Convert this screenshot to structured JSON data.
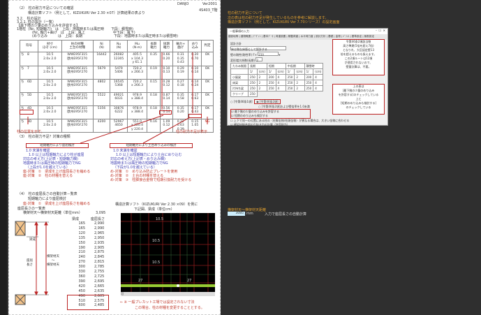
{
  "header": {
    "danjo": "DANJO",
    "ver": "Ver2001",
    "sheet": "4S403_T階"
  },
  "sec2": {
    "title": "（2）　柱の耐力不足についての確認",
    "sub": "構造計算ソフト（例として、KIZUKURI Ver 2.30 ×07）計算結果の表より",
    "l1": "3.2.　柱の設計",
    "l2": "3.2.1. 柱の設計（一覧）",
    "l3": "【最下階の少量のめり込みを許容する】",
    "l4a": "1階柱",
    "l4b": "(Nc, 短期軸力)　は　上段：地震時または風圧時　　下段：積雪時)",
    "l5": "(Nc, 軸力+曲げ　は　上段：風上　　　　　　　　中下段：風下)",
    "l6": "(めり込み　　　は　上段：長期　　　　　　　　　下段：地震時または風圧時または積雪時)"
  },
  "table": {
    "headers": [
      "符号",
      "材寸\nほぞ (cm)",
      "柱の材種\n土台の材種",
      "Ni\n(N)",
      "Nu\n(N)",
      "Mu\n(N·m)",
      "長期\n軸力",
      "短期\n軸力",
      "軸力+\n曲げ",
      "めり\n込み",
      "判定"
    ],
    "rows": [
      [
        "ち　8",
        "10.5\n2.0x 2.0",
        "WWE95F315\n欧州E95F270",
        "16442",
        "26082\n12305",
        "405.5\nx 104.3\ny 61.1",
        "0.35",
        "0.66\n0.20",
        "0.31\n0.35\n0.43",
        "0.20\n0.70",
        "OK"
      ],
      [
        "ち　7",
        "10.5\n2.0x 2.0",
        "WWE95F315\n欧州E95F270",
        "5679",
        "5479\n5406",
        "720.2\nx 266.3",
        "0.19",
        "0.10\n0.13",
        "0.29\n0.19",
        "0.10\n0.14",
        "OK"
      ],
      [
        "ち　6D",
        "10.5\n2.0x 2.0",
        "WWE95F315\n欧州E95F270",
        "4802",
        "16545\n5368",
        "720.2\nx 266.3",
        "0.15",
        "0.28\n0.12",
        "0.27\n0.18",
        "0.14\n0.24",
        "OK"
      ],
      [
        "ち　5D",
        "10.5\n2.0x 2.0",
        "WWE95F315\n欧州E95F270",
        "5522",
        "49021\n6031",
        "978.9\nx 388.4",
        "0.18",
        "0.87\n0.14",
        "0.35\n0.58",
        "0.17\n0.63",
        "OK"
      ],
      [
        "ち　4D",
        "10.5\n2.0x 2.0",
        "WWE95F315\n欧州E95F270",
        "5356",
        "30876\n6222",
        "978.9\nx 388.4",
        "0.18",
        "0.56\n0.14",
        "0.35\n0.20",
        "0.17\n0.43",
        "OK"
      ],
      [
        "ち　3D",
        "10.5\n2.0x 2.0",
        "WWE95F315\n欧州E95F270",
        "4200",
        "52967\n4650",
        "551.0\nx 220.4\ny 220.4",
        "0.16",
        "1.09\n0.12",
        "0.22\n0.63\n0.39",
        "0.15\n1.05",
        "NG"
      ]
    ]
  },
  "notes": {
    "left": "柱の位置を示す。",
    "right": "柱の耐力不足が表示"
  },
  "sec3": {
    "title": "（3）　柱の耐力不足？対策の種類",
    "left": {
      "box": "短期軸力により座屈検討",
      "lines": [
        "1.0 未満を確認",
        "1.0 以上は短期軸力により柱が座屈",
        "対応の考え方(上記表・短期軸力欄)",
        "地震時または風圧時の短期軸力でNG",
        "（上段が1.0を越えている）",
        "座-対策　①　梁成を上げ座屈長さを縮める",
        "座-対策　②　柱の材種を替える"
      ]
    },
    "right": {
      "box": "短期軸力により土台めり込みの検討",
      "lines": [
        "1.0 未満を確認",
        "1.0 以上は短期軸力により土台にめり込む",
        "対応の考え方(上記表・めり込み欄)",
        "地震時または風圧時の短期軸力でNG",
        "（下段が1.0を越えている）",
        "め-対策　①　めり込み防止プレートを使用",
        "め-対策　②　土台の材種を替える",
        "め-対策　③　柱脚接合金物で短期引抜耐力を受ける"
      ]
    }
  },
  "sec4": {
    "title": "（4）　柱の座屈長さの自動計算－覧表",
    "l1": "短期軸力により座屈検討",
    "l2": "座-対策　①　梁成を上げ座屈長さを縮める",
    "l3": "座屈長さの一覧表",
    "l4": "横架材天～横架材天距離（単位mm）",
    "l4v": "3,095",
    "h1": "梁成",
    "h2": "座屈長さ",
    "beam": [
      "165",
      "165",
      "120",
      "135",
      "150",
      "190",
      "210",
      "240",
      "270",
      "300",
      "330",
      "360",
      "390",
      "420",
      "450",
      "490",
      "510",
      "600"
    ],
    "len": [
      "2,990",
      "2,990",
      "2,965",
      "2,950",
      "2,935",
      "2,905",
      "2,875",
      "2,845",
      "2,815",
      "2,785",
      "2,755",
      "2,725",
      "2,695",
      "2,665",
      "2,635",
      "2,605",
      "2,575",
      "2,485"
    ],
    "diag": {
      "beam": "梁成",
      "between": "横架材天\n～\n横架材天",
      "buckle": "座屈\n長さ"
    },
    "cad_title": "構造計算ソフト（KIZUKURI Ver 2.30 ×09）を例に",
    "cad_sub": "下記図、梁成（単位cm）",
    "cad_labels": [
      "10.5",
      "10.5",
      "10.5",
      "27",
      "27"
    ],
    "cad_tab": "可",
    "foot1": "← ※ 一般プレカット工場では設定されない寸法",
    "foot2": "この場合、柱の材種を変更することとする。"
  },
  "right": {
    "t1": "柱の耐力不足について",
    "t2": "次の表は柱の耐力不足が発生しているものを参考に解説します。",
    "t3": "構造計算ソフト（例として、KIZUKURI Ver 7.70シリーズ）の設定画面",
    "dialog": {
      "title": "一般事項の入力",
      "tabs": "建設地等 | 建物概要 | ﾃﾞｻﾞｲﾝ | 基本ﾃﾞｰﾀ | 荷重設置 | 積載荷重 | 水平荷力度 | 設計方針 | 基礎 | 金物 | ﾊﾞﾗﾝｽ | 基準設定 | 無断設定",
      "section": "設計方針",
      "r1": "床は剛な床版として設計する",
      "r2": "壁の剛性(剛性率) F×",
      "r2v": "150",
      "r3": "変形増大係数(長期)",
      "r3v": "2",
      "tawami": "たわみ制限",
      "cols": [
        "長期",
        "短期",
        "中長期",
        "積雪時"
      ],
      "sub": [
        "1/",
        "(cm)"
      ],
      "rows": [
        [
          "小屋梁",
          "250",
          "2",
          "200",
          "4",
          "250",
          "2",
          "200",
          "4"
        ],
        [
          "床梁",
          "250",
          "2",
          "250",
          "4",
          "250",
          "2",
          "250",
          "4"
        ],
        [
          "片持ち梁",
          "250",
          "2",
          "250",
          "4",
          "250",
          "2",
          "250",
          "4"
        ]
      ],
      "creep": "クリープ",
      "creepv": "250",
      "opt1": "[令第46条1項]",
      "opt2": "[令第46条2項]",
      "opt3": "[令第46条2項]および壁倍率を1.0未満",
      "c1": "最下階の少量のめり込みを許容する",
      "c2": "短期のめり込みも検討する",
      "c3": "上下で同一の位置にある柱の（柱脚金物/柱頭金物）が異なる場合は、大きい金物に合わせる",
      "c4": "横架材接合部の引抜き力の計算（許容耐力）"
    },
    "note1": [
      "令第46条2項該当物",
      "高さ準建(5倍を超え7倍)",
      "となりれ、大臣認定壁13",
      "倍を超えるものも扱えます。",
      "この2項ルートは12項",
      "が適用されないので、",
      "壁量計算は、不要。"
    ],
    "note2": [
      "上の表は",
      "[最下階の少量のめり込み",
      "を許容する]のチェックしている",
      "上と",
      "[短期のめり込みも検討する]",
      "のチェックしている"
    ],
    "calc_label": "横架材天～横架材天距離",
    "calc_value": "3085",
    "calc_unit": "mm",
    "calc_note": "入力で座屈長さの自動計算"
  },
  "colors": {
    "bg": "#2f2f2f",
    "accent": "#c0392b",
    "yellow": "#e0a030"
  }
}
